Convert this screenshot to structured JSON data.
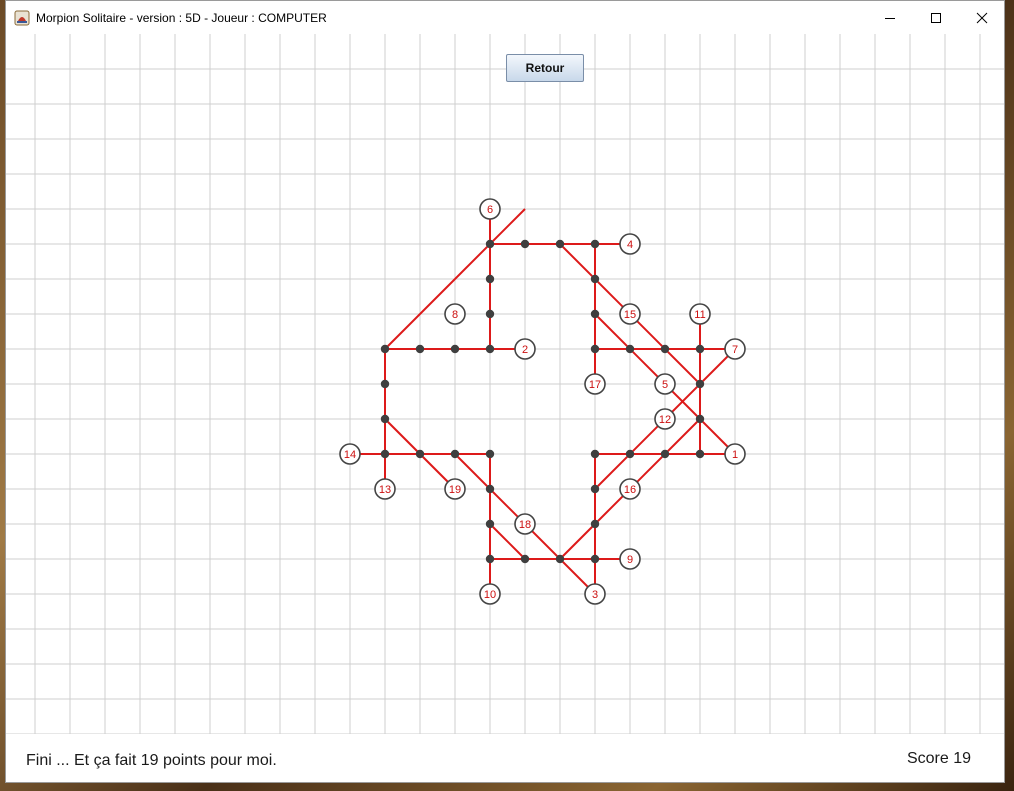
{
  "window": {
    "title": "Morpion Solitaire - version : 5D - Joueur : COMPUTER"
  },
  "toolbar": {
    "retour_label": "Retour"
  },
  "status": {
    "message": "Fini ... Et ça fait 19 points pour moi.",
    "score": "Score 19"
  },
  "colors": {
    "line": "#dd1a1a",
    "dot": "#3f3f3f",
    "grid": "#cfcfcf",
    "label": "#cc1010"
  },
  "game": {
    "dots": [
      [
        13,
        6
      ],
      [
        14,
        6
      ],
      [
        15,
        6
      ],
      [
        13,
        7
      ],
      [
        13,
        8
      ],
      [
        10,
        9
      ],
      [
        11,
        9
      ],
      [
        12,
        9
      ],
      [
        13,
        9
      ],
      [
        10,
        10
      ],
      [
        10,
        11
      ],
      [
        10,
        12
      ],
      [
        11,
        12
      ],
      [
        12,
        12
      ],
      [
        13,
        12
      ],
      [
        13,
        13
      ],
      [
        13,
        14
      ],
      [
        13,
        15
      ],
      [
        14,
        15
      ],
      [
        15,
        15
      ],
      [
        16,
        15
      ],
      [
        16,
        14
      ],
      [
        16,
        13
      ],
      [
        16,
        12
      ],
      [
        17,
        12
      ],
      [
        18,
        12
      ],
      [
        19,
        12
      ],
      [
        19,
        11
      ],
      [
        19,
        10
      ],
      [
        19,
        9
      ],
      [
        18,
        9
      ],
      [
        17,
        9
      ],
      [
        16,
        9
      ],
      [
        16,
        8
      ],
      [
        16,
        7
      ],
      [
        16,
        6
      ]
    ],
    "moves": [
      {
        "n": "1",
        "c": [
          20,
          12
        ]
      },
      {
        "n": "2",
        "c": [
          14,
          9
        ]
      },
      {
        "n": "3",
        "c": [
          16,
          16
        ]
      },
      {
        "n": "4",
        "c": [
          17,
          6
        ]
      },
      {
        "n": "5",
        "c": [
          18,
          10
        ]
      },
      {
        "n": "6",
        "c": [
          13,
          5
        ]
      },
      {
        "n": "7",
        "c": [
          20,
          9
        ]
      },
      {
        "n": "8",
        "c": [
          12,
          8
        ]
      },
      {
        "n": "9",
        "c": [
          17,
          15
        ]
      },
      {
        "n": "10",
        "c": [
          13,
          16
        ]
      },
      {
        "n": "11",
        "c": [
          19,
          8
        ]
      },
      {
        "n": "12",
        "c": [
          18,
          11
        ]
      },
      {
        "n": "13",
        "c": [
          10,
          13
        ]
      },
      {
        "n": "14",
        "c": [
          9,
          12
        ]
      },
      {
        "n": "15",
        "c": [
          17,
          8
        ]
      },
      {
        "n": "16",
        "c": [
          17,
          13
        ]
      },
      {
        "n": "17",
        "c": [
          16,
          10
        ]
      },
      {
        "n": "18",
        "c": [
          14,
          14
        ]
      },
      {
        "n": "19",
        "c": [
          12,
          13
        ]
      }
    ],
    "lines": [
      [
        [
          16,
          6
        ],
        [
          17,
          6
        ]
      ],
      [
        [
          13,
          5
        ],
        [
          13,
          9
        ]
      ],
      [
        [
          13,
          6
        ],
        [
          16,
          6
        ]
      ],
      [
        [
          10,
          9
        ],
        [
          14,
          9
        ]
      ],
      [
        [
          16,
          9
        ],
        [
          20,
          9
        ]
      ],
      [
        [
          9,
          12
        ],
        [
          13,
          12
        ]
      ],
      [
        [
          16,
          12
        ],
        [
          20,
          12
        ]
      ],
      [
        [
          13,
          15
        ],
        [
          16,
          15
        ]
      ],
      [
        [
          16,
          15
        ],
        [
          17,
          15
        ]
      ],
      [
        [
          10,
          9
        ],
        [
          10,
          13
        ]
      ],
      [
        [
          16,
          6
        ],
        [
          16,
          10
        ]
      ],
      [
        [
          19,
          8
        ],
        [
          19,
          12
        ]
      ],
      [
        [
          13,
          12
        ],
        [
          13,
          16
        ]
      ],
      [
        [
          16,
          12
        ],
        [
          16,
          16
        ]
      ],
      [
        [
          10,
          9
        ],
        [
          14,
          5
        ]
      ],
      [
        [
          10,
          11
        ],
        [
          12,
          13
        ]
      ],
      [
        [
          12,
          12
        ],
        [
          16,
          16
        ]
      ],
      [
        [
          13,
          14
        ],
        [
          14,
          15
        ]
      ],
      [
        [
          15,
          6
        ],
        [
          19,
          10
        ]
      ],
      [
        [
          16,
          8
        ],
        [
          20,
          12
        ]
      ],
      [
        [
          16,
          13
        ],
        [
          20,
          9
        ]
      ],
      [
        [
          16,
          14
        ],
        [
          19,
          11
        ]
      ],
      [
        [
          15,
          15
        ],
        [
          16,
          14
        ]
      ]
    ]
  }
}
